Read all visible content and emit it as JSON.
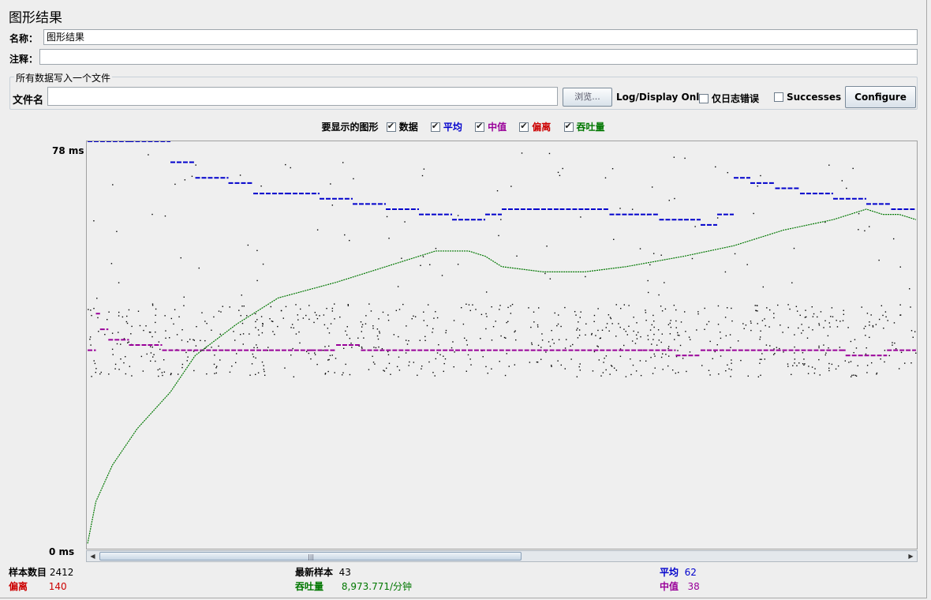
{
  "title": "图形结果",
  "name_label": "名称：",
  "name_value": "图形结果",
  "comment_label": "注释：",
  "comment_value": "",
  "file_group_title": "所有数据写入一个文件",
  "file_label": "文件名",
  "file_value": "",
  "browse_label": "浏览...",
  "log_display_label": "Log/Display Only:",
  "errors_only_label": "仅日志错误",
  "successes_label": "Successes",
  "configure_label": "Configure",
  "graphs_to_show_label": "要显示的图形",
  "legend": [
    {
      "label": "数据",
      "checked": true,
      "color": "#000000"
    },
    {
      "label": "平均",
      "checked": true,
      "color": "#0000cc"
    },
    {
      "label": "中值",
      "checked": true,
      "color": "#990099"
    },
    {
      "label": "偏离",
      "checked": true,
      "color": "#cc0000"
    },
    {
      "label": "吞吐量",
      "checked": true,
      "color": "#007700"
    }
  ],
  "y_max_label": "78  ms",
  "y_min_label": "0  ms",
  "stats": {
    "samples_label": "样本数目",
    "samples_value": "2412",
    "latest_label": "最新样本",
    "latest_value": "43",
    "average_label": "平均",
    "average_value": "62",
    "deviation_label": "偏离",
    "deviation_value": "140",
    "throughput_label": "吞吐量",
    "throughput_value": "8,973.771/分钟",
    "median_label": "中值",
    "median_value": "38"
  },
  "chart_data": {
    "type": "scatter",
    "ylim": [
      0,
      78
    ],
    "y_unit": "ms",
    "colors": {
      "data": "#000000",
      "average": "#0000cc",
      "median": "#990099",
      "deviation": "#cc0000",
      "throughput": "#007700"
    },
    "average_steps": [
      [
        0.0,
        78
      ],
      [
        0.05,
        78
      ],
      [
        0.1,
        74
      ],
      [
        0.13,
        71
      ],
      [
        0.17,
        70
      ],
      [
        0.2,
        68
      ],
      [
        0.24,
        68
      ],
      [
        0.28,
        67
      ],
      [
        0.32,
        66
      ],
      [
        0.36,
        65
      ],
      [
        0.4,
        64
      ],
      [
        0.44,
        63
      ],
      [
        0.48,
        64
      ],
      [
        0.5,
        65
      ],
      [
        0.54,
        65
      ],
      [
        0.57,
        65
      ],
      [
        0.6,
        65
      ],
      [
        0.63,
        64
      ],
      [
        0.66,
        64
      ],
      [
        0.69,
        63
      ],
      [
        0.72,
        63
      ],
      [
        0.74,
        62
      ],
      [
        0.76,
        64
      ],
      [
        0.78,
        71
      ],
      [
        0.8,
        70
      ],
      [
        0.83,
        69
      ],
      [
        0.86,
        68
      ],
      [
        0.9,
        67
      ],
      [
        0.94,
        66
      ],
      [
        0.97,
        65
      ],
      [
        1.0,
        66
      ]
    ],
    "median_steps": [
      [
        0.0,
        38
      ],
      [
        0.01,
        45
      ],
      [
        0.015,
        42
      ],
      [
        0.025,
        40
      ],
      [
        0.05,
        39
      ],
      [
        0.09,
        38
      ],
      [
        0.27,
        38
      ],
      [
        0.3,
        39
      ],
      [
        0.33,
        38
      ],
      [
        0.67,
        38
      ],
      [
        0.71,
        37
      ],
      [
        0.74,
        38
      ],
      [
        0.91,
        38
      ],
      [
        0.915,
        37
      ],
      [
        0.965,
        38
      ],
      [
        1.0,
        38
      ]
    ],
    "throughput_points": [
      [
        0.0,
        1
      ],
      [
        0.01,
        9
      ],
      [
        0.03,
        16
      ],
      [
        0.06,
        23
      ],
      [
        0.1,
        30
      ],
      [
        0.13,
        37
      ],
      [
        0.18,
        43
      ],
      [
        0.23,
        48
      ],
      [
        0.3,
        51
      ],
      [
        0.36,
        54
      ],
      [
        0.42,
        57
      ],
      [
        0.46,
        57
      ],
      [
        0.48,
        56
      ],
      [
        0.5,
        54
      ],
      [
        0.55,
        53
      ],
      [
        0.6,
        53
      ],
      [
        0.65,
        54
      ],
      [
        0.72,
        56
      ],
      [
        0.78,
        58
      ],
      [
        0.84,
        61
      ],
      [
        0.9,
        63
      ],
      [
        0.94,
        65
      ],
      [
        0.96,
        64
      ],
      [
        0.98,
        64
      ],
      [
        1.0,
        63
      ]
    ]
  }
}
